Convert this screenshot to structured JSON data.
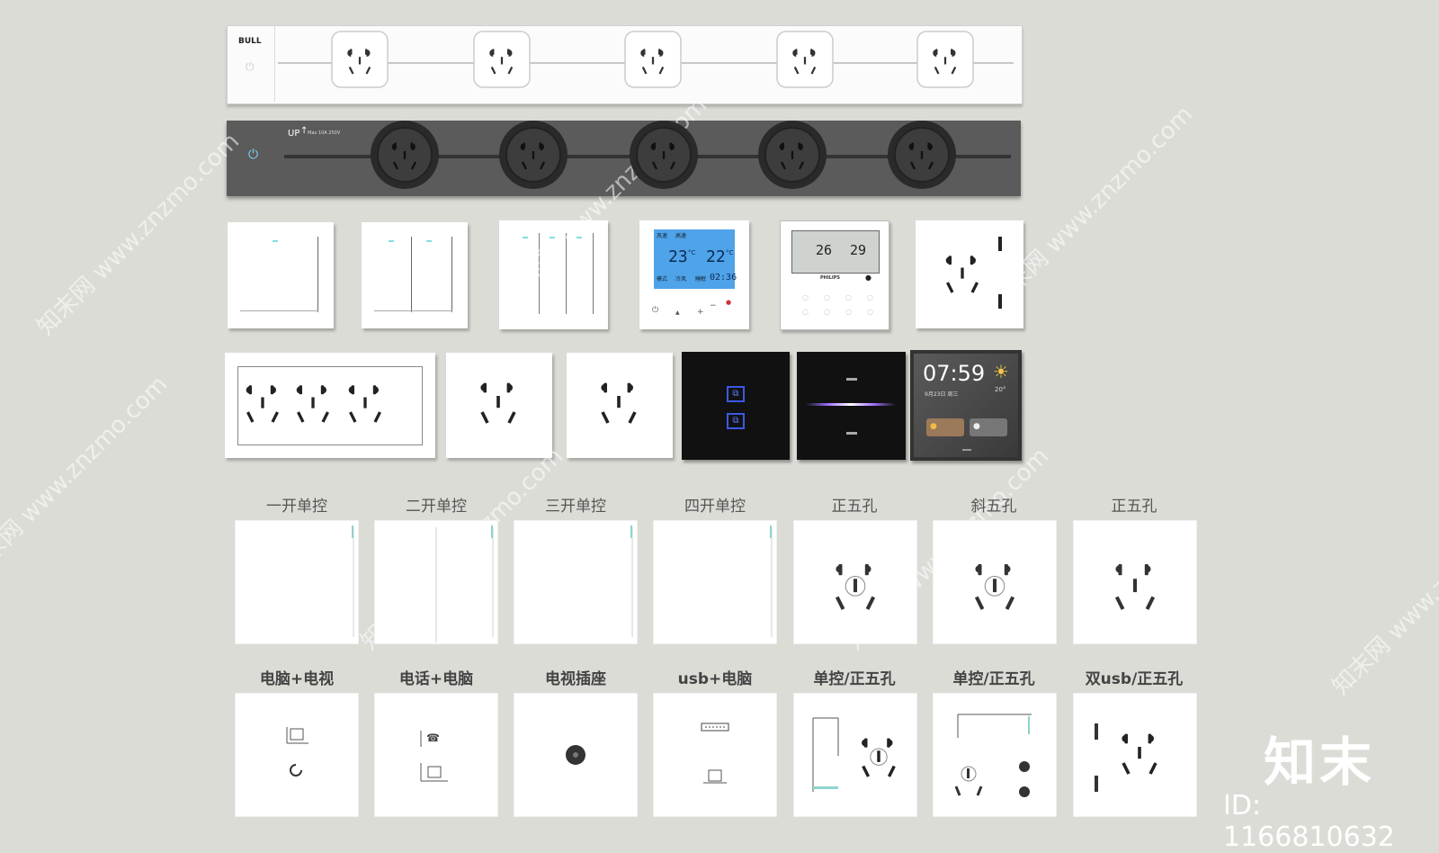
{
  "strip_white": {
    "brand": "BULL",
    "socket_count": 5
  },
  "strip_dark": {
    "brand": "UP",
    "spec": "Max 10A 250V",
    "socket_count": 5
  },
  "thermostat_blue": {
    "top_left": "风速",
    "top_right": "高速",
    "temp_left": "23",
    "temp_right": "22",
    "unit": "°C",
    "mode": "模式",
    "cool": "冷风",
    "sleep": "睡眠",
    "time": "02:36"
  },
  "thermostat_lcd": {
    "temp_left": "26",
    "temp_right": "29",
    "brand": "PHILIPS"
  },
  "smart_panel": {
    "time": "07:59",
    "date": "9月23日 周三",
    "temp": "20°"
  },
  "row1_labels": [
    "一开单控",
    "二开单控",
    "三开单控",
    "四开单控",
    "正五孔",
    "斜五孔",
    "正五孔"
  ],
  "row2_labels": [
    "电脑+电视",
    "电话+电脑",
    "电视插座",
    "usb+电脑",
    "单控/正五孔",
    "单控/正五孔",
    "双usb/正五孔"
  ],
  "watermark": "知末网 www.znzmo.com",
  "logo": "知末",
  "id_text": "ID: 1166810632",
  "colors": {
    "background": "#dcdcd7",
    "dark_strip": "#5b5b5b",
    "lcd_blue": "#4fa3e8"
  }
}
